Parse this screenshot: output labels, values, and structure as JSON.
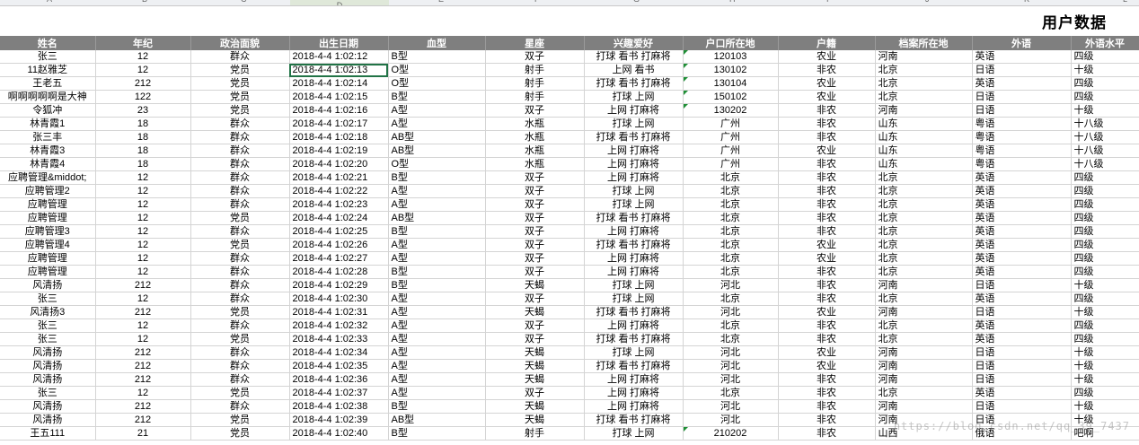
{
  "title": "用户数据",
  "column_letters": [
    "A",
    "B",
    "C",
    "D",
    "E",
    "F",
    "G",
    "H",
    "I",
    "J",
    "K",
    "L"
  ],
  "headers": [
    "姓名",
    "年纪",
    "政治面貌",
    "出生日期",
    "血型",
    "星座",
    "兴趣爱好",
    "户口所在地",
    "户籍",
    "档案所在地",
    "外语",
    "外语水平"
  ],
  "rows": [
    [
      "张三",
      "12",
      "群众",
      "2018-4-4 1:02:12",
      "B型",
      "双子",
      "打球 看书 打麻将",
      "120103",
      "农业",
      "河南",
      "英语",
      "四级"
    ],
    [
      "11赵雅芝",
      "12",
      "党员",
      "2018-4-4 1:02:13",
      "O型",
      "射手",
      "上网 看书",
      "130102",
      "非农",
      "北京",
      "日语",
      "十级"
    ],
    [
      "王老五",
      "212",
      "党员",
      "2018-4-4 1:02:14",
      "O型",
      "射手",
      "打球 看书 打麻将",
      "130104",
      "农业",
      "北京",
      "英语",
      "四级"
    ],
    [
      "啊啊啊啊啊是大神",
      "122",
      "党员",
      "2018-4-4 1:02:15",
      "B型",
      "射手",
      "打球 上网",
      "150102",
      "农业",
      "北京",
      "日语",
      "四级"
    ],
    [
      "令狐冲",
      "23",
      "党员",
      "2018-4-4 1:02:16",
      "A型",
      "双子",
      "上网 打麻将",
      "130202",
      "非农",
      "河南",
      "日语",
      "十级"
    ],
    [
      "林青霞1",
      "18",
      "群众",
      "2018-4-4 1:02:17",
      "A型",
      "水瓶",
      "打球 上网",
      "广州",
      "非农",
      "山东",
      "粤语",
      "十八级"
    ],
    [
      "张三丰",
      "18",
      "群众",
      "2018-4-4 1:02:18",
      "AB型",
      "水瓶",
      "打球 看书 打麻将",
      "广州",
      "非农",
      "山东",
      "粤语",
      "十八级"
    ],
    [
      "林青霞3",
      "18",
      "群众",
      "2018-4-4 1:02:19",
      "AB型",
      "水瓶",
      "上网 打麻将",
      "广州",
      "农业",
      "山东",
      "粤语",
      "十八级"
    ],
    [
      "林青霞4",
      "18",
      "群众",
      "2018-4-4 1:02:20",
      "O型",
      "水瓶",
      "上网 打麻将",
      "广州",
      "非农",
      "山东",
      "粤语",
      "十八级"
    ],
    [
      "应聘管理&middot;",
      "12",
      "群众",
      "2018-4-4 1:02:21",
      "B型",
      "双子",
      "上网 打麻将",
      "北京",
      "非农",
      "北京",
      "英语",
      "四级"
    ],
    [
      "应聘管理2",
      "12",
      "群众",
      "2018-4-4 1:02:22",
      "A型",
      "双子",
      "打球 上网",
      "北京",
      "非农",
      "北京",
      "英语",
      "四级"
    ],
    [
      "应聘管理",
      "12",
      "群众",
      "2018-4-4 1:02:23",
      "A型",
      "双子",
      "打球 上网",
      "北京",
      "非农",
      "北京",
      "英语",
      "四级"
    ],
    [
      "应聘管理",
      "12",
      "党员",
      "2018-4-4 1:02:24",
      "AB型",
      "双子",
      "打球 看书 打麻将",
      "北京",
      "非农",
      "北京",
      "英语",
      "四级"
    ],
    [
      "应聘管理3",
      "12",
      "群众",
      "2018-4-4 1:02:25",
      "B型",
      "双子",
      "上网 打麻将",
      "北京",
      "非农",
      "北京",
      "英语",
      "四级"
    ],
    [
      "应聘管理4",
      "12",
      "党员",
      "2018-4-4 1:02:26",
      "A型",
      "双子",
      "打球 看书 打麻将",
      "北京",
      "农业",
      "北京",
      "英语",
      "四级"
    ],
    [
      "应聘管理",
      "12",
      "群众",
      "2018-4-4 1:02:27",
      "A型",
      "双子",
      "上网 打麻将",
      "北京",
      "农业",
      "北京",
      "英语",
      "四级"
    ],
    [
      "应聘管理",
      "12",
      "群众",
      "2018-4-4 1:02:28",
      "B型",
      "双子",
      "上网 打麻将",
      "北京",
      "非农",
      "北京",
      "英语",
      "四级"
    ],
    [
      "风清扬",
      "212",
      "群众",
      "2018-4-4 1:02:29",
      "B型",
      "天蝎",
      "打球 上网",
      "河北",
      "非农",
      "河南",
      "日语",
      "十级"
    ],
    [
      "张三",
      "12",
      "群众",
      "2018-4-4 1:02:30",
      "A型",
      "双子",
      "打球 上网",
      "北京",
      "非农",
      "北京",
      "英语",
      "四级"
    ],
    [
      "风清扬3",
      "212",
      "党员",
      "2018-4-4 1:02:31",
      "A型",
      "天蝎",
      "打球 看书 打麻将",
      "河北",
      "农业",
      "河南",
      "日语",
      "十级"
    ],
    [
      "张三",
      "12",
      "群众",
      "2018-4-4 1:02:32",
      "A型",
      "双子",
      "上网 打麻将",
      "北京",
      "非农",
      "北京",
      "英语",
      "四级"
    ],
    [
      "张三",
      "12",
      "党员",
      "2018-4-4 1:02:33",
      "A型",
      "双子",
      "打球 看书 打麻将",
      "北京",
      "非农",
      "北京",
      "英语",
      "四级"
    ],
    [
      "风清扬",
      "212",
      "群众",
      "2018-4-4 1:02:34",
      "A型",
      "天蝎",
      "打球 上网",
      "河北",
      "农业",
      "河南",
      "日语",
      "十级"
    ],
    [
      "风清扬",
      "212",
      "群众",
      "2018-4-4 1:02:35",
      "A型",
      "天蝎",
      "打球 看书 打麻将",
      "河北",
      "农业",
      "河南",
      "日语",
      "十级"
    ],
    [
      "风清扬",
      "212",
      "群众",
      "2018-4-4 1:02:36",
      "A型",
      "天蝎",
      "上网 打麻将",
      "河北",
      "非农",
      "河南",
      "日语",
      "十级"
    ],
    [
      "张三",
      "12",
      "党员",
      "2018-4-4 1:02:37",
      "A型",
      "双子",
      "上网 打麻将",
      "北京",
      "非农",
      "北京",
      "英语",
      "四级"
    ],
    [
      "风清扬",
      "212",
      "群众",
      "2018-4-4 1:02:38",
      "B型",
      "天蝎",
      "上网 打麻将",
      "河北",
      "非农",
      "河南",
      "日语",
      "十级"
    ],
    [
      "风清扬",
      "212",
      "党员",
      "2018-4-4 1:02:39",
      "AB型",
      "天蝎",
      "打球 看书 打麻将",
      "河北",
      "非农",
      "河南",
      "日语",
      "十级"
    ],
    [
      "王五111",
      "21",
      "党员",
      "2018-4-4 1:02:40",
      "B型",
      "射手",
      "打球 上网",
      "210202",
      "非农",
      "山西",
      "俄语",
      "吧啊"
    ]
  ],
  "watermark": "https://blog.csdn.net/qq_39_7437"
}
